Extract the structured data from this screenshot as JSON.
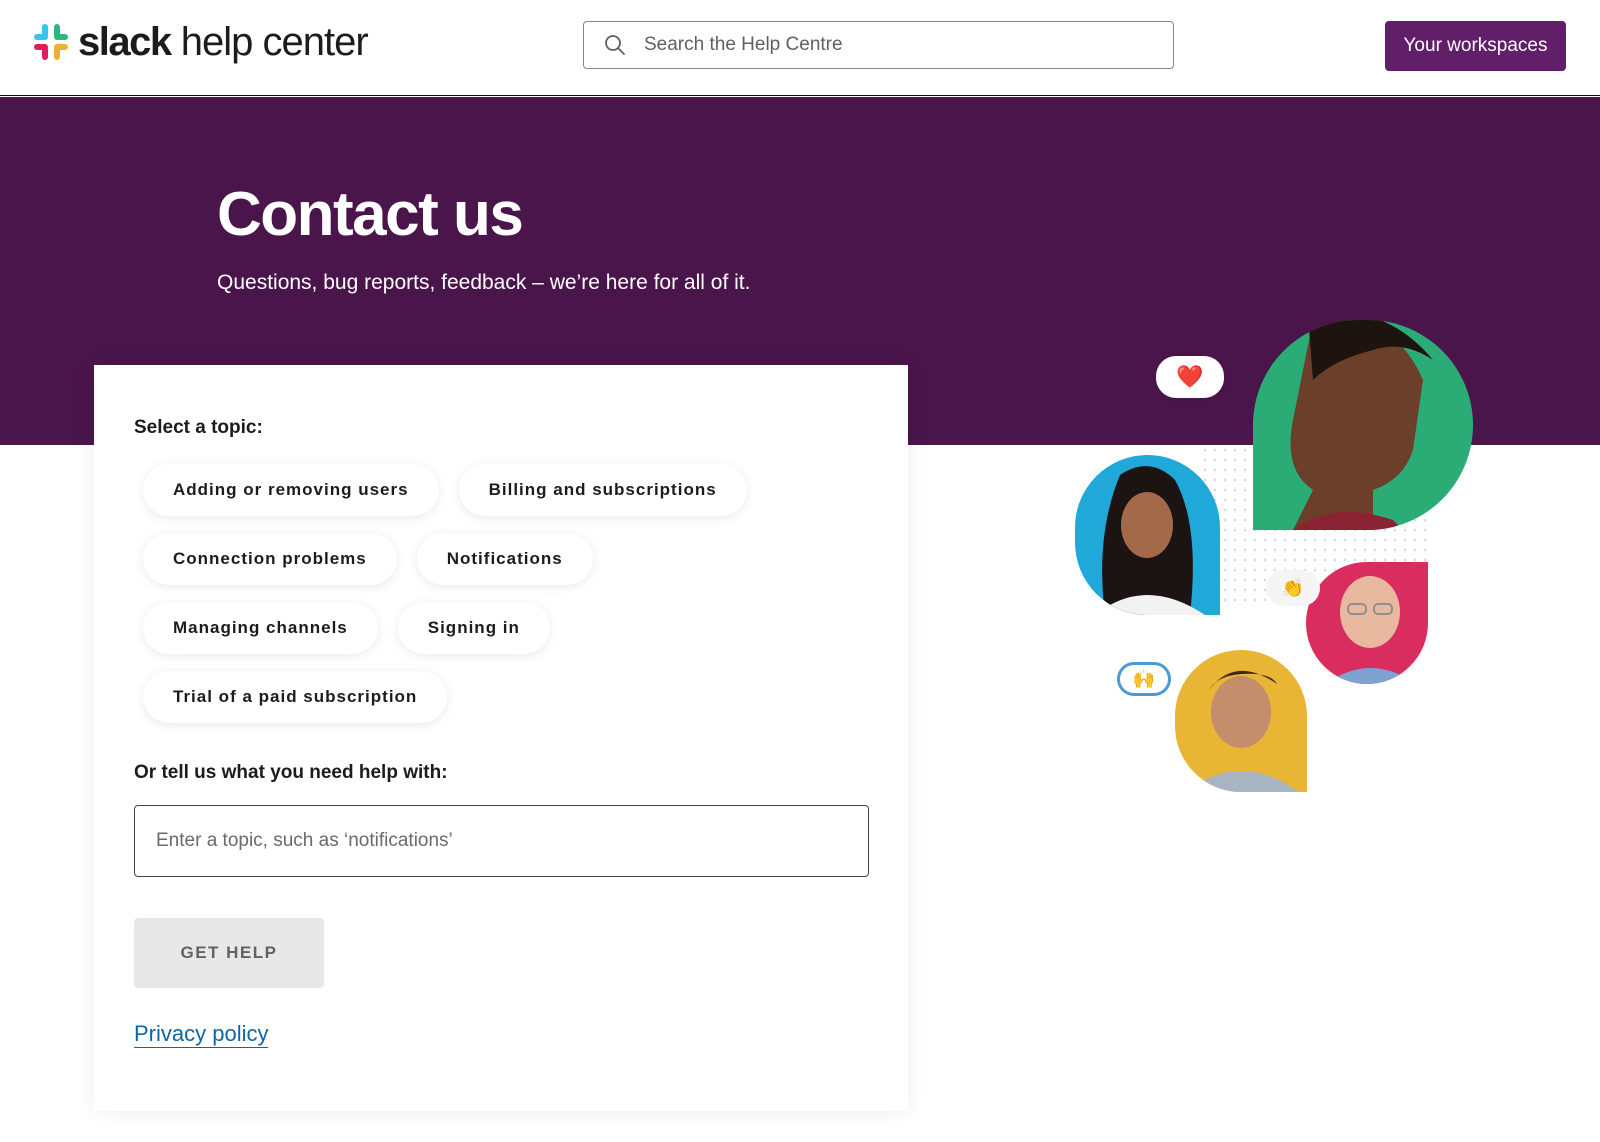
{
  "header": {
    "logo_brand": "slack",
    "logo_suffix": "help center",
    "search_placeholder": "Search the Help Centre",
    "workspaces_label": "Your workspaces"
  },
  "hero": {
    "title": "Contact us",
    "subtitle": "Questions, bug reports, feedback – we’re here for all of it."
  },
  "form": {
    "topic_heading": "Select a topic:",
    "topics": [
      "Adding or removing users",
      "Billing and subscriptions",
      "Connection problems",
      "Notifications",
      "Managing channels",
      "Signing in",
      "Trial of a paid subscription"
    ],
    "freeform_heading": "Or tell us what you need help with:",
    "freeform_placeholder": "Enter a topic, such as ‘notifications’",
    "submit_label": "GET HELP",
    "privacy_label": "Privacy policy"
  },
  "illustration": {
    "reactions": [
      "❤️",
      "👏",
      "🙌"
    ],
    "photo_backgrounds": {
      "green": "#2bac76",
      "blue": "#1fa8d8",
      "red": "#d92d60",
      "yellow": "#e8b634"
    }
  },
  "colors": {
    "brand_purple": "#4a154b",
    "button_purple": "#611f69",
    "link_blue": "#1264a3"
  }
}
